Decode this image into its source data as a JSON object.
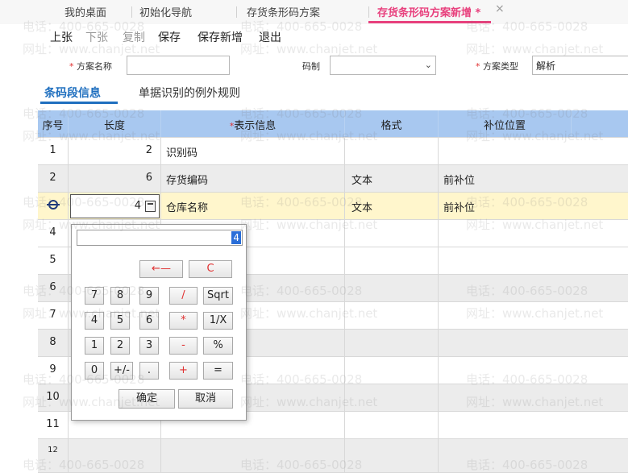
{
  "tabs": [
    {
      "label": "我的桌面"
    },
    {
      "label": "初始化导航"
    },
    {
      "label": "存货条形码方案"
    },
    {
      "label": "存货条形码方案新增 *"
    }
  ],
  "tab_close": "×",
  "toolbar": {
    "prev": "上张",
    "next": "下张",
    "copy": "复制",
    "save": "保存",
    "save_new": "保存新增",
    "exit": "退出"
  },
  "form": {
    "scheme_name_label": "方案名称",
    "scheme_name_value": "",
    "code_label": "码制",
    "code_value": "",
    "scheme_type_label": "方案类型",
    "scheme_type_value": "解析",
    "required_mark": "*"
  },
  "subtabs": [
    {
      "label": "条码段信息"
    },
    {
      "label": "单据识别的例外规则"
    }
  ],
  "grid": {
    "headers": [
      "序号",
      "长度",
      "表示信息",
      "格式",
      "补位位置"
    ],
    "header_required_mark": "*",
    "rows": [
      {
        "seq": "1",
        "length": "2",
        "name": "识别码",
        "format": "",
        "padding": ""
      },
      {
        "seq": "2",
        "length": "6",
        "name": "存货编码",
        "format": "文本",
        "padding": "前补位"
      },
      {
        "seq": "",
        "length": "4",
        "name": "仓库名称",
        "format": "文本",
        "padding": "前补位"
      },
      {
        "seq": "4",
        "length": "",
        "name": "",
        "format": "",
        "padding": ""
      },
      {
        "seq": "5",
        "length": "",
        "name": "",
        "format": "",
        "padding": ""
      },
      {
        "seq": "6",
        "length": "",
        "name": "",
        "format": "",
        "padding": ""
      },
      {
        "seq": "7",
        "length": "",
        "name": "",
        "format": "",
        "padding": ""
      },
      {
        "seq": "8",
        "length": "",
        "name": "",
        "format": "",
        "padding": ""
      },
      {
        "seq": "9",
        "length": "",
        "name": "",
        "format": "",
        "padding": ""
      },
      {
        "seq": "10",
        "length": "",
        "name": "",
        "format": "",
        "padding": ""
      },
      {
        "seq": "11",
        "length": "",
        "name": "",
        "format": "",
        "padding": ""
      },
      {
        "seq": "12",
        "length": "",
        "name": "",
        "format": "",
        "padding": ""
      }
    ]
  },
  "calculator": {
    "display": "4",
    "backspace": "←—",
    "clear": "C",
    "keys": [
      "7",
      "8",
      "9",
      "/",
      "Sqrt",
      "4",
      "5",
      "6",
      "*",
      "1/X",
      "1",
      "2",
      "3",
      "-",
      "%",
      "0",
      "+/-",
      ".",
      "+",
      "="
    ],
    "confirm": "确定",
    "cancel": "取消"
  },
  "watermark": {
    "phone": "电话：400-665-0028",
    "site": "网址：www.chanjet.net"
  },
  "colors": {
    "active_tab": "#e8407d",
    "subtab_active": "#1f6fbf",
    "grid_header": "#a8c8f0",
    "selected_row": "#fff6cc"
  }
}
